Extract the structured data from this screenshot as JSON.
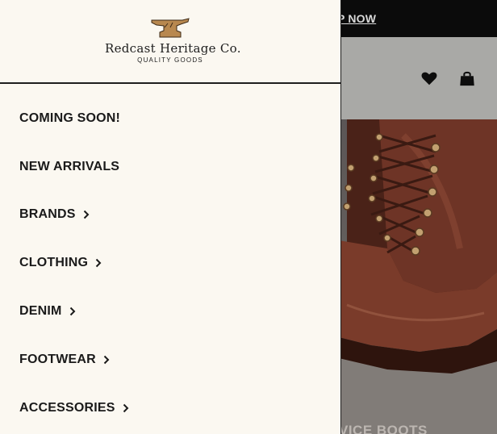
{
  "announcement": {
    "link_text": "P NOW"
  },
  "header_icons": {
    "wishlist": "heart-icon",
    "cart": "shopping-bag-icon"
  },
  "hero": {
    "caption": "VICE BOOTS"
  },
  "brand": {
    "name": "Redcast Heritage Co.",
    "tagline": "QUALITY GOODS",
    "logo_icon": "anvil-icon",
    "accent": "#b8884f"
  },
  "menu": {
    "items": [
      {
        "label": "COMING SOON!",
        "has_submenu": false
      },
      {
        "label": "NEW ARRIVALS",
        "has_submenu": false
      },
      {
        "label": "BRANDS",
        "has_submenu": true
      },
      {
        "label": "CLOTHING",
        "has_submenu": true
      },
      {
        "label": "DENIM",
        "has_submenu": true
      },
      {
        "label": "FOOTWEAR",
        "has_submenu": true
      },
      {
        "label": "ACCESSORIES",
        "has_submenu": true
      }
    ],
    "chevron_icon": "chevron-right-icon"
  },
  "colors": {
    "drawer_bg": "#fbf8f1",
    "text": "#1a1a1a",
    "announcement_bg": "#0b0b0b"
  }
}
